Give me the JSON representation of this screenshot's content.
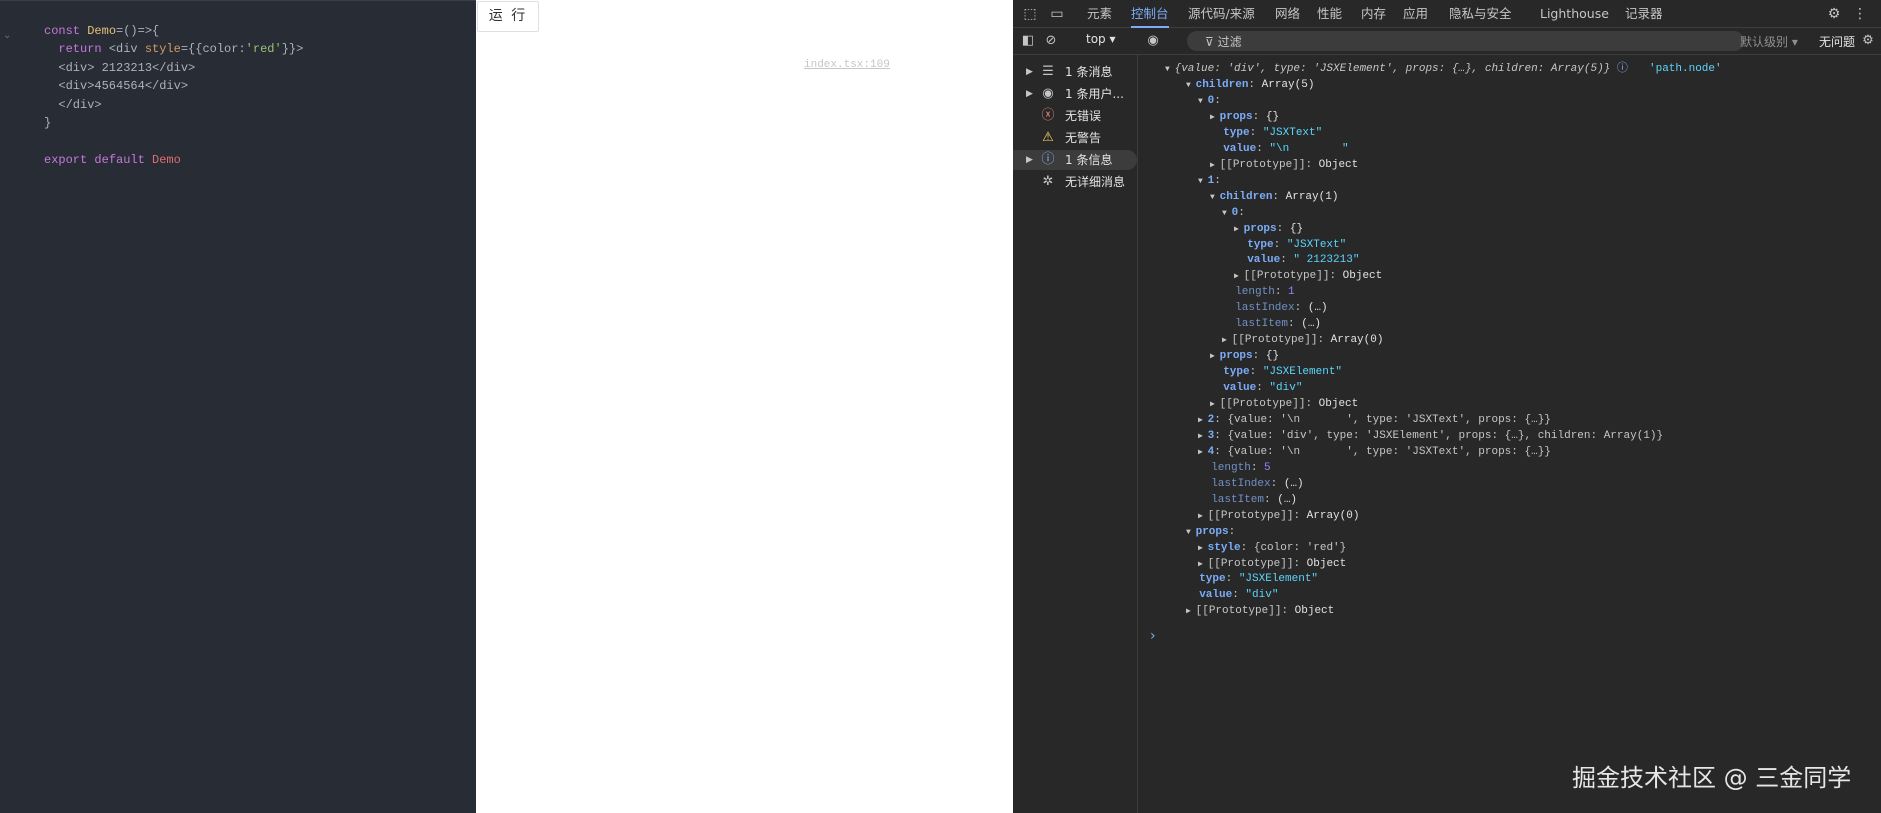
{
  "editor": {
    "lines": [
      {
        "segments": [
          {
            "t": "const ",
            "c": "kw"
          },
          {
            "t": "Demo",
            "c": "fn"
          },
          {
            "t": "=()=>{",
            "c": "plain"
          }
        ]
      },
      {
        "segments": [
          {
            "t": "  return ",
            "c": "kw"
          },
          {
            "t": "<div ",
            "c": "plain"
          },
          {
            "t": "style",
            "c": "attr"
          },
          {
            "t": "={{",
            "c": "plain"
          },
          {
            "t": "color",
            "c": "plain"
          },
          {
            "t": ":",
            "c": "plain"
          },
          {
            "t": "'red'",
            "c": "str"
          },
          {
            "t": "}}>",
            "c": "plain"
          }
        ]
      },
      {
        "segments": [
          {
            "t": "  <div> 2123213</div>",
            "c": "plain"
          }
        ]
      },
      {
        "segments": [
          {
            "t": "  <div>4564564</div>",
            "c": "plain"
          }
        ]
      },
      {
        "segments": [
          {
            "t": "  </div>",
            "c": "plain"
          }
        ]
      },
      {
        "segments": [
          {
            "t": "}",
            "c": "plain"
          }
        ]
      },
      {
        "segments": [
          {
            "t": "",
            "c": "plain"
          }
        ]
      },
      {
        "segments": [
          {
            "t": "export ",
            "c": "kw"
          },
          {
            "t": "default ",
            "c": "def"
          },
          {
            "t": "Demo",
            "c": "name"
          }
        ]
      }
    ]
  },
  "preview": {
    "run_label": "运 行"
  },
  "devtools": {
    "tabs": [
      "元素",
      "控制台",
      "源代码/来源",
      "网络",
      "性能",
      "内存",
      "应用",
      "隐私与安全",
      "Lighthouse",
      "记录器"
    ],
    "active_tab": "控制台",
    "context": "top",
    "filter_placeholder": "过滤",
    "level": "默认级别",
    "issues": "无问题",
    "sidebar": [
      {
        "label": "1 条消息",
        "icon": "list-icon",
        "arrow": true
      },
      {
        "label": "1 条用户...",
        "icon": "user-icon",
        "arrow": true
      },
      {
        "label": "无错误",
        "icon": "error-icon",
        "arrow": false
      },
      {
        "label": "无警告",
        "icon": "warning-icon",
        "arrow": false
      },
      {
        "label": "1 条信息",
        "icon": "info-icon",
        "arrow": true,
        "selected": true
      },
      {
        "label": "无详细消息",
        "icon": "bug-icon",
        "arrow": false
      }
    ],
    "source_link": "index.tsx:109",
    "log_label": "'path.node'",
    "log_summary": "{value: 'div', type: 'JSXElement', props: {…}, children: Array(5)}",
    "tree": [
      {
        "d": 0,
        "tri": "down",
        "k": "children",
        "v": "Array(5)"
      },
      {
        "d": 1,
        "tri": "down",
        "k": "0",
        "v": ""
      },
      {
        "d": 2,
        "tri": "right",
        "k": "props",
        "v": "{}"
      },
      {
        "d": 2,
        "k": "type",
        "v": "\"JSXText\"",
        "vt": "s"
      },
      {
        "d": 2,
        "k": "value",
        "v": "\"\\n        \"",
        "vt": "s"
      },
      {
        "d": 2,
        "tri": "right",
        "k": "[[Prototype]]",
        "v": "Object",
        "proto": true
      },
      {
        "d": 1,
        "tri": "down",
        "k": "1",
        "v": ""
      },
      {
        "d": 2,
        "tri": "down",
        "k": "children",
        "v": "Array(1)"
      },
      {
        "d": 3,
        "tri": "down",
        "k": "0",
        "v": ""
      },
      {
        "d": 4,
        "tri": "right",
        "k": "props",
        "v": "{}"
      },
      {
        "d": 4,
        "k": "type",
        "v": "\"JSXText\"",
        "vt": "s"
      },
      {
        "d": 4,
        "k": "value",
        "v": "\" 2123213\"",
        "vt": "s"
      },
      {
        "d": 4,
        "tri": "right",
        "k": "[[Prototype]]",
        "v": "Object",
        "proto": true
      },
      {
        "d": 3,
        "k": "length",
        "v": "1",
        "vt": "n",
        "dim": true
      },
      {
        "d": 3,
        "k": "lastIndex",
        "v": "(…)",
        "dim": true
      },
      {
        "d": 3,
        "k": "lastItem",
        "v": "(…)",
        "dim": true
      },
      {
        "d": 3,
        "tri": "right",
        "k": "[[Prototype]]",
        "v": "Array(0)",
        "proto": true
      },
      {
        "d": 2,
        "tri": "right",
        "k": "props",
        "v": "{}"
      },
      {
        "d": 2,
        "k": "type",
        "v": "\"JSXElement\"",
        "vt": "s"
      },
      {
        "d": 2,
        "k": "value",
        "v": "\"div\"",
        "vt": "s"
      },
      {
        "d": 2,
        "tri": "right",
        "k": "[[Prototype]]",
        "v": "Object",
        "proto": true
      },
      {
        "d": 1,
        "tri": "right",
        "k": "2",
        "v": "{value: '\\n       ', type: 'JSXText', props: {…}}",
        "obj": true
      },
      {
        "d": 1,
        "tri": "right",
        "k": "3",
        "v": "{value: 'div', type: 'JSXElement', props: {…}, children: Array(1)}",
        "obj": true
      },
      {
        "d": 1,
        "tri": "right",
        "k": "4",
        "v": "{value: '\\n       ', type: 'JSXText', props: {…}}",
        "obj": true
      },
      {
        "d": 1,
        "k": "length",
        "v": "5",
        "vt": "n",
        "dim": true
      },
      {
        "d": 1,
        "k": "lastIndex",
        "v": "(…)",
        "dim": true
      },
      {
        "d": 1,
        "k": "lastItem",
        "v": "(…)",
        "dim": true
      },
      {
        "d": 1,
        "tri": "right",
        "k": "[[Prototype]]",
        "v": "Array(0)",
        "proto": true
      },
      {
        "d": 0,
        "tri": "down",
        "k": "props",
        "v": ""
      },
      {
        "d": 1,
        "tri": "right",
        "k": "style",
        "v": "{color: 'red'}",
        "obj": true
      },
      {
        "d": 1,
        "tri": "right",
        "k": "[[Prototype]]",
        "v": "Object",
        "proto": true
      },
      {
        "d": 0,
        "k": "type",
        "v": "\"JSXElement\"",
        "vt": "s"
      },
      {
        "d": 0,
        "k": "value",
        "v": "\"div\"",
        "vt": "s"
      },
      {
        "d": 0,
        "tri": "right",
        "k": "[[Prototype]]",
        "v": "Object",
        "proto": true
      }
    ]
  },
  "watermark": "掘金技术社区 @ 三金同学"
}
